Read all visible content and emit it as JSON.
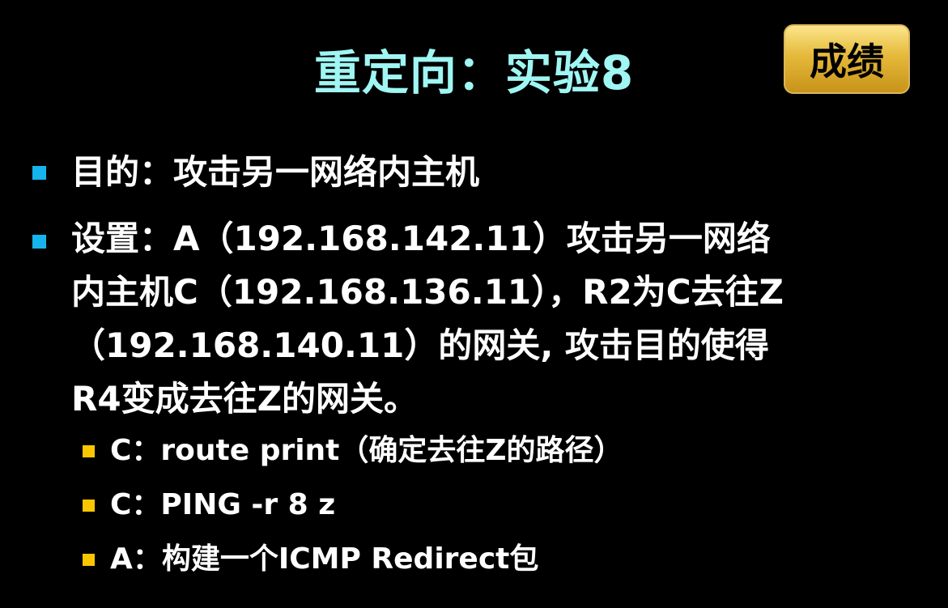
{
  "slide": {
    "title": "重定向：实验8",
    "score_button_label": "成绩",
    "bullets": [
      {
        "text_lines": [
          "目的：攻击另一网络内主机"
        ]
      },
      {
        "text_lines": [
          "设置：A（192.168.142.11）攻击另一网络",
          "内主机C（192.168.136.11），R2为C去往Z",
          "（192.168.140.11）的网关, 攻击目的使得",
          "R4变成去往Z的网关。"
        ]
      }
    ],
    "sub_bullets": [
      {
        "text": "C：route print（确定去往Z的路径）"
      },
      {
        "text": "C：PING -r 8 z"
      },
      {
        "text": "A：构建一个ICMP Redirect包"
      }
    ],
    "colors": {
      "background": "#000000",
      "title": "#9ff6f3",
      "bullet_primary": "#16b4ec",
      "bullet_secondary": "#f9c600",
      "button_gold": "#e5b93a"
    }
  }
}
